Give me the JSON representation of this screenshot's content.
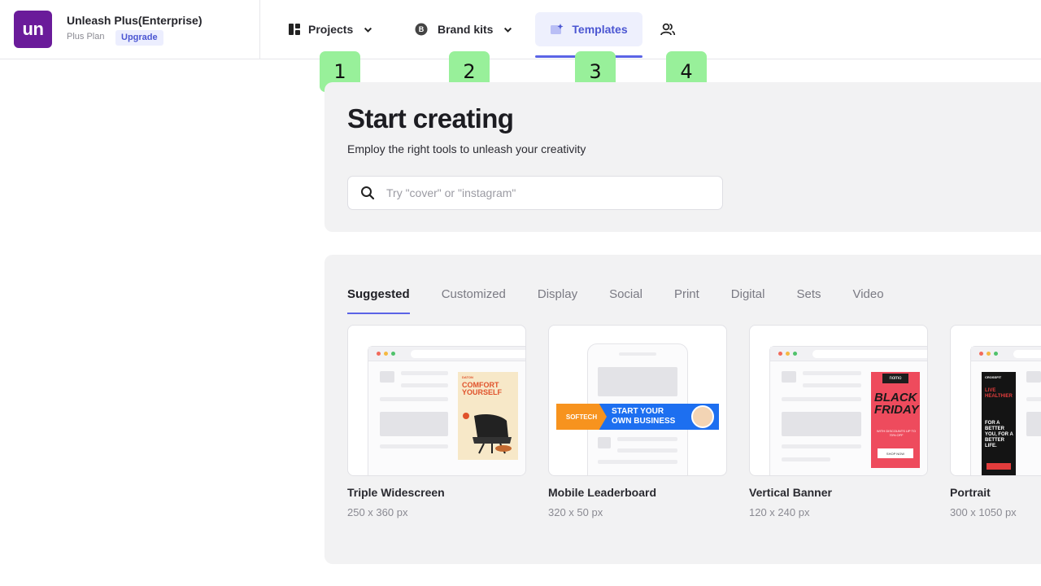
{
  "workspace": {
    "logo_text": "un",
    "name": "Unleash Plus(Enterprise)",
    "plan": "Plus Plan",
    "upgrade_label": "Upgrade"
  },
  "nav": {
    "projects_label": "Projects",
    "brand_kits_label": "Brand kits",
    "brand_kits_badge": "B",
    "templates_label": "Templates"
  },
  "markers": [
    "1",
    "2",
    "3",
    "4"
  ],
  "hero": {
    "title": "Start creating",
    "subtitle": "Employ the right tools to unleash your creativity",
    "search_placeholder": "Try \"cover\" or \"instagram\""
  },
  "category_tabs": [
    "Suggested",
    "Customized",
    "Display",
    "Social",
    "Print",
    "Digital",
    "Sets",
    "Video"
  ],
  "active_tab": "Suggested",
  "templates": [
    {
      "name": "Triple Widescreen",
      "size": "250 x 360 px",
      "ad_title": "COMFORT YOURSELF",
      "ad_brand": "DATON"
    },
    {
      "name": "Mobile Leaderboard",
      "size": "320 x 50 px",
      "ad_brand": "SOFTECH",
      "ad_title": "START YOUR OWN BUSINESS"
    },
    {
      "name": "Vertical Banner",
      "size": "120 x 240 px",
      "ad_brand": "nomo",
      "ad_title": "BLACK FRIDAY",
      "ad_sub": "WITH DISCOUNTS UP TO 70% OFF",
      "ad_button": "SHOP NOW"
    },
    {
      "name": "Portrait",
      "size": "300 x 1050 px",
      "ad_brand": "CROSSFIT",
      "ad_title": "LIVE HEALTHIER",
      "ad_sub": "FOR A BETTER YOU, FOR A BETTER LIFE."
    }
  ],
  "colors": {
    "brand": "#6a1b9a",
    "accent": "#5b64e6",
    "marker": "#98f09a",
    "panel_bg": "#f2f2f3"
  }
}
